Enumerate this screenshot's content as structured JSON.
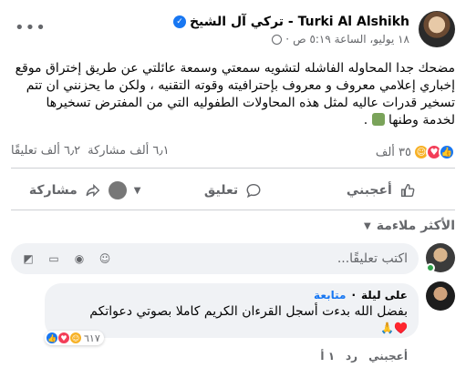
{
  "post": {
    "author": "Turki Al Alshikh - تركي آل الشيخ",
    "timestamp": "١٨ يوليو، الساعة ٥:١٩ ص",
    "privacy_icon": "globe-icon",
    "more_label": "•••",
    "text": "مضحك جدا المحاوله الفاشله لتشويه سمعتي وسمعة عائلتي عن طريق إختراق موقع إخباري إعلامي معروف و معروف بإحترافيته وقوته التقنيه ، ولكن ما يحزنني ان تتم تسخير قدرات عاليه لمثل هذه المحاولات الطفوليه التي من المفترض تسخيرها لخدمة وطنها",
    "text_tail": " ."
  },
  "stats": {
    "reactions_count": "٣٥ ألف",
    "comments_count": "٦٫٢ ألف تعليقًا",
    "shares_count": "٦٫١ ألف مشاركة"
  },
  "actions": {
    "like": "أعجبني",
    "comment": "تعليق",
    "share": "مشاركة"
  },
  "filter": {
    "label": "الأكثر ملاءمة"
  },
  "composer": {
    "placeholder": "اكتب تعليقًا..."
  },
  "comment": {
    "author": "على ليلة",
    "follow": "متابعة",
    "text": "بفضل الله بدءت أسجل القرءان الكريم كاملا بصوتي دعواتكم",
    "emojis": "♥️🙏",
    "reaction_count": "٦١٧",
    "like": "أعجبني",
    "reply": "رد",
    "age": "١ أ"
  },
  "colors": {
    "accent": "#1877f2",
    "secondary_text": "#65676b",
    "love": "#f33e58",
    "haha": "#f7b125"
  }
}
